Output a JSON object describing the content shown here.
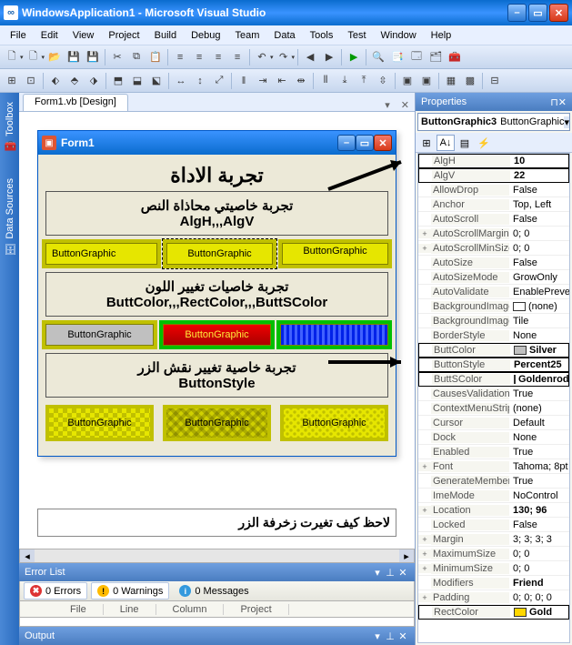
{
  "title": "WindowsApplication1 - Microsoft Visual Studio",
  "menu": [
    "File",
    "Edit",
    "View",
    "Project",
    "Build",
    "Debug",
    "Team",
    "Data",
    "Tools",
    "Test",
    "Window",
    "Help"
  ],
  "doc_tab": "Form1.vb [Design]",
  "form": {
    "title": "Form1",
    "heading": "تجربة الاداة",
    "box1_ar": "تجربة خاصيتي محاذاة النص",
    "box1_en": "AlgH,,,AlgV",
    "btn_label": "ButtonGraphic",
    "box2_ar": "تجربة خاصيات تغيير اللون",
    "box2_en": "ButtColor,,,RectColor,,,ButtSColor",
    "box3_ar": "تجربة خاصية تغيير نقش الزر",
    "box3_en": "ButtonStyle",
    "caption": "لاحظ كيف تغيرت زخرفة الزر"
  },
  "errorlist": {
    "title": "Error List",
    "errors": "0 Errors",
    "warnings": "0 Warnings",
    "messages": "0 Messages",
    "cols": [
      "",
      "File",
      "Line",
      "Column",
      "Project"
    ]
  },
  "output_title": "Output",
  "properties": {
    "title": "Properties",
    "object_bold": "ButtonGraphic3",
    "object_rest": "ButtonGraphic",
    "rows": [
      {
        "exp": "",
        "name": "AlgH",
        "val": "10",
        "bold": true,
        "hl": true
      },
      {
        "exp": "",
        "name": "AlgV",
        "val": "22",
        "bold": true,
        "hl": true
      },
      {
        "exp": "",
        "name": "AllowDrop",
        "val": "False"
      },
      {
        "exp": "",
        "name": "Anchor",
        "val": "Top, Left"
      },
      {
        "exp": "",
        "name": "AutoScroll",
        "val": "False"
      },
      {
        "exp": "+",
        "name": "AutoScrollMargin",
        "val": "0; 0"
      },
      {
        "exp": "+",
        "name": "AutoScrollMinSize",
        "val": "0; 0"
      },
      {
        "exp": "",
        "name": "AutoSize",
        "val": "False"
      },
      {
        "exp": "",
        "name": "AutoSizeMode",
        "val": "GrowOnly"
      },
      {
        "exp": "",
        "name": "AutoValidate",
        "val": "EnablePrevent"
      },
      {
        "exp": "",
        "name": "BackgroundImage",
        "val": "(none)",
        "swatch": "#fff"
      },
      {
        "exp": "",
        "name": "BackgroundImageLayout",
        "val": "Tile"
      },
      {
        "exp": "",
        "name": "BorderStyle",
        "val": "None"
      },
      {
        "exp": "",
        "name": "ButtColor",
        "val": "Silver",
        "bold": true,
        "hl": true,
        "swatch": "#c0c0c0"
      },
      {
        "exp": "",
        "name": "ButtonStyle",
        "val": "Percent25",
        "bold": true,
        "hl": true
      },
      {
        "exp": "",
        "name": "ButtSColor",
        "val": "Goldenrod",
        "bold": true,
        "hl": true,
        "swatch": "#daa520"
      },
      {
        "exp": "",
        "name": "CausesValidation",
        "val": "True"
      },
      {
        "exp": "",
        "name": "ContextMenuStrip",
        "val": "(none)"
      },
      {
        "exp": "",
        "name": "Cursor",
        "val": "Default"
      },
      {
        "exp": "",
        "name": "Dock",
        "val": "None"
      },
      {
        "exp": "",
        "name": "Enabled",
        "val": "True"
      },
      {
        "exp": "+",
        "name": "Font",
        "val": "Tahoma; 8pt"
      },
      {
        "exp": "",
        "name": "GenerateMember",
        "val": "True"
      },
      {
        "exp": "",
        "name": "ImeMode",
        "val": "NoControl"
      },
      {
        "exp": "+",
        "name": "Location",
        "val": "130; 96",
        "bold": true
      },
      {
        "exp": "",
        "name": "Locked",
        "val": "False"
      },
      {
        "exp": "+",
        "name": "Margin",
        "val": "3; 3; 3; 3"
      },
      {
        "exp": "+",
        "name": "MaximumSize",
        "val": "0; 0"
      },
      {
        "exp": "+",
        "name": "MinimumSize",
        "val": "0; 0"
      },
      {
        "exp": "",
        "name": "Modifiers",
        "val": "Friend",
        "bold": true
      },
      {
        "exp": "+",
        "name": "Padding",
        "val": "0; 0; 0; 0"
      },
      {
        "exp": "",
        "name": "RectColor",
        "val": "Gold",
        "bold": true,
        "hl": true,
        "swatch": "#ffd700"
      }
    ]
  }
}
